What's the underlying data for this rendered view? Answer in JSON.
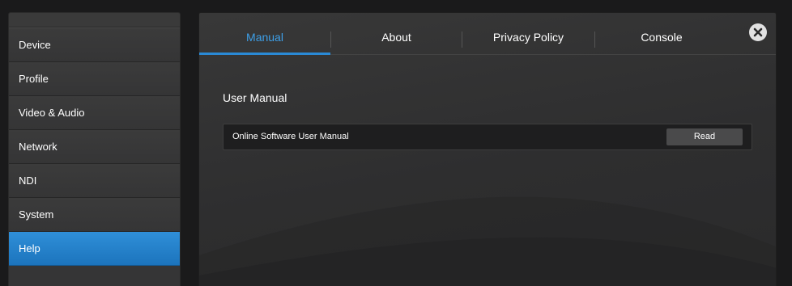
{
  "sidebar": {
    "items": [
      {
        "label": "Device",
        "active": false
      },
      {
        "label": "Profile",
        "active": false
      },
      {
        "label": "Video & Audio",
        "active": false
      },
      {
        "label": "Network",
        "active": false
      },
      {
        "label": "NDI",
        "active": false
      },
      {
        "label": "System",
        "active": false
      },
      {
        "label": "Help",
        "active": true
      }
    ]
  },
  "tabs": [
    {
      "label": "Manual",
      "active": true
    },
    {
      "label": "About",
      "active": false
    },
    {
      "label": "Privacy Policy",
      "active": false
    },
    {
      "label": "Console",
      "active": false
    }
  ],
  "close_icon": "close-icon",
  "content": {
    "section_title": "User Manual",
    "row_label": "Online Software User Manual",
    "read_label": "Read"
  },
  "colors": {
    "accent": "#2a8ad6",
    "active_tab_text": "#3d9fe8",
    "background": "#1a1a1b",
    "panel": "#333334"
  }
}
